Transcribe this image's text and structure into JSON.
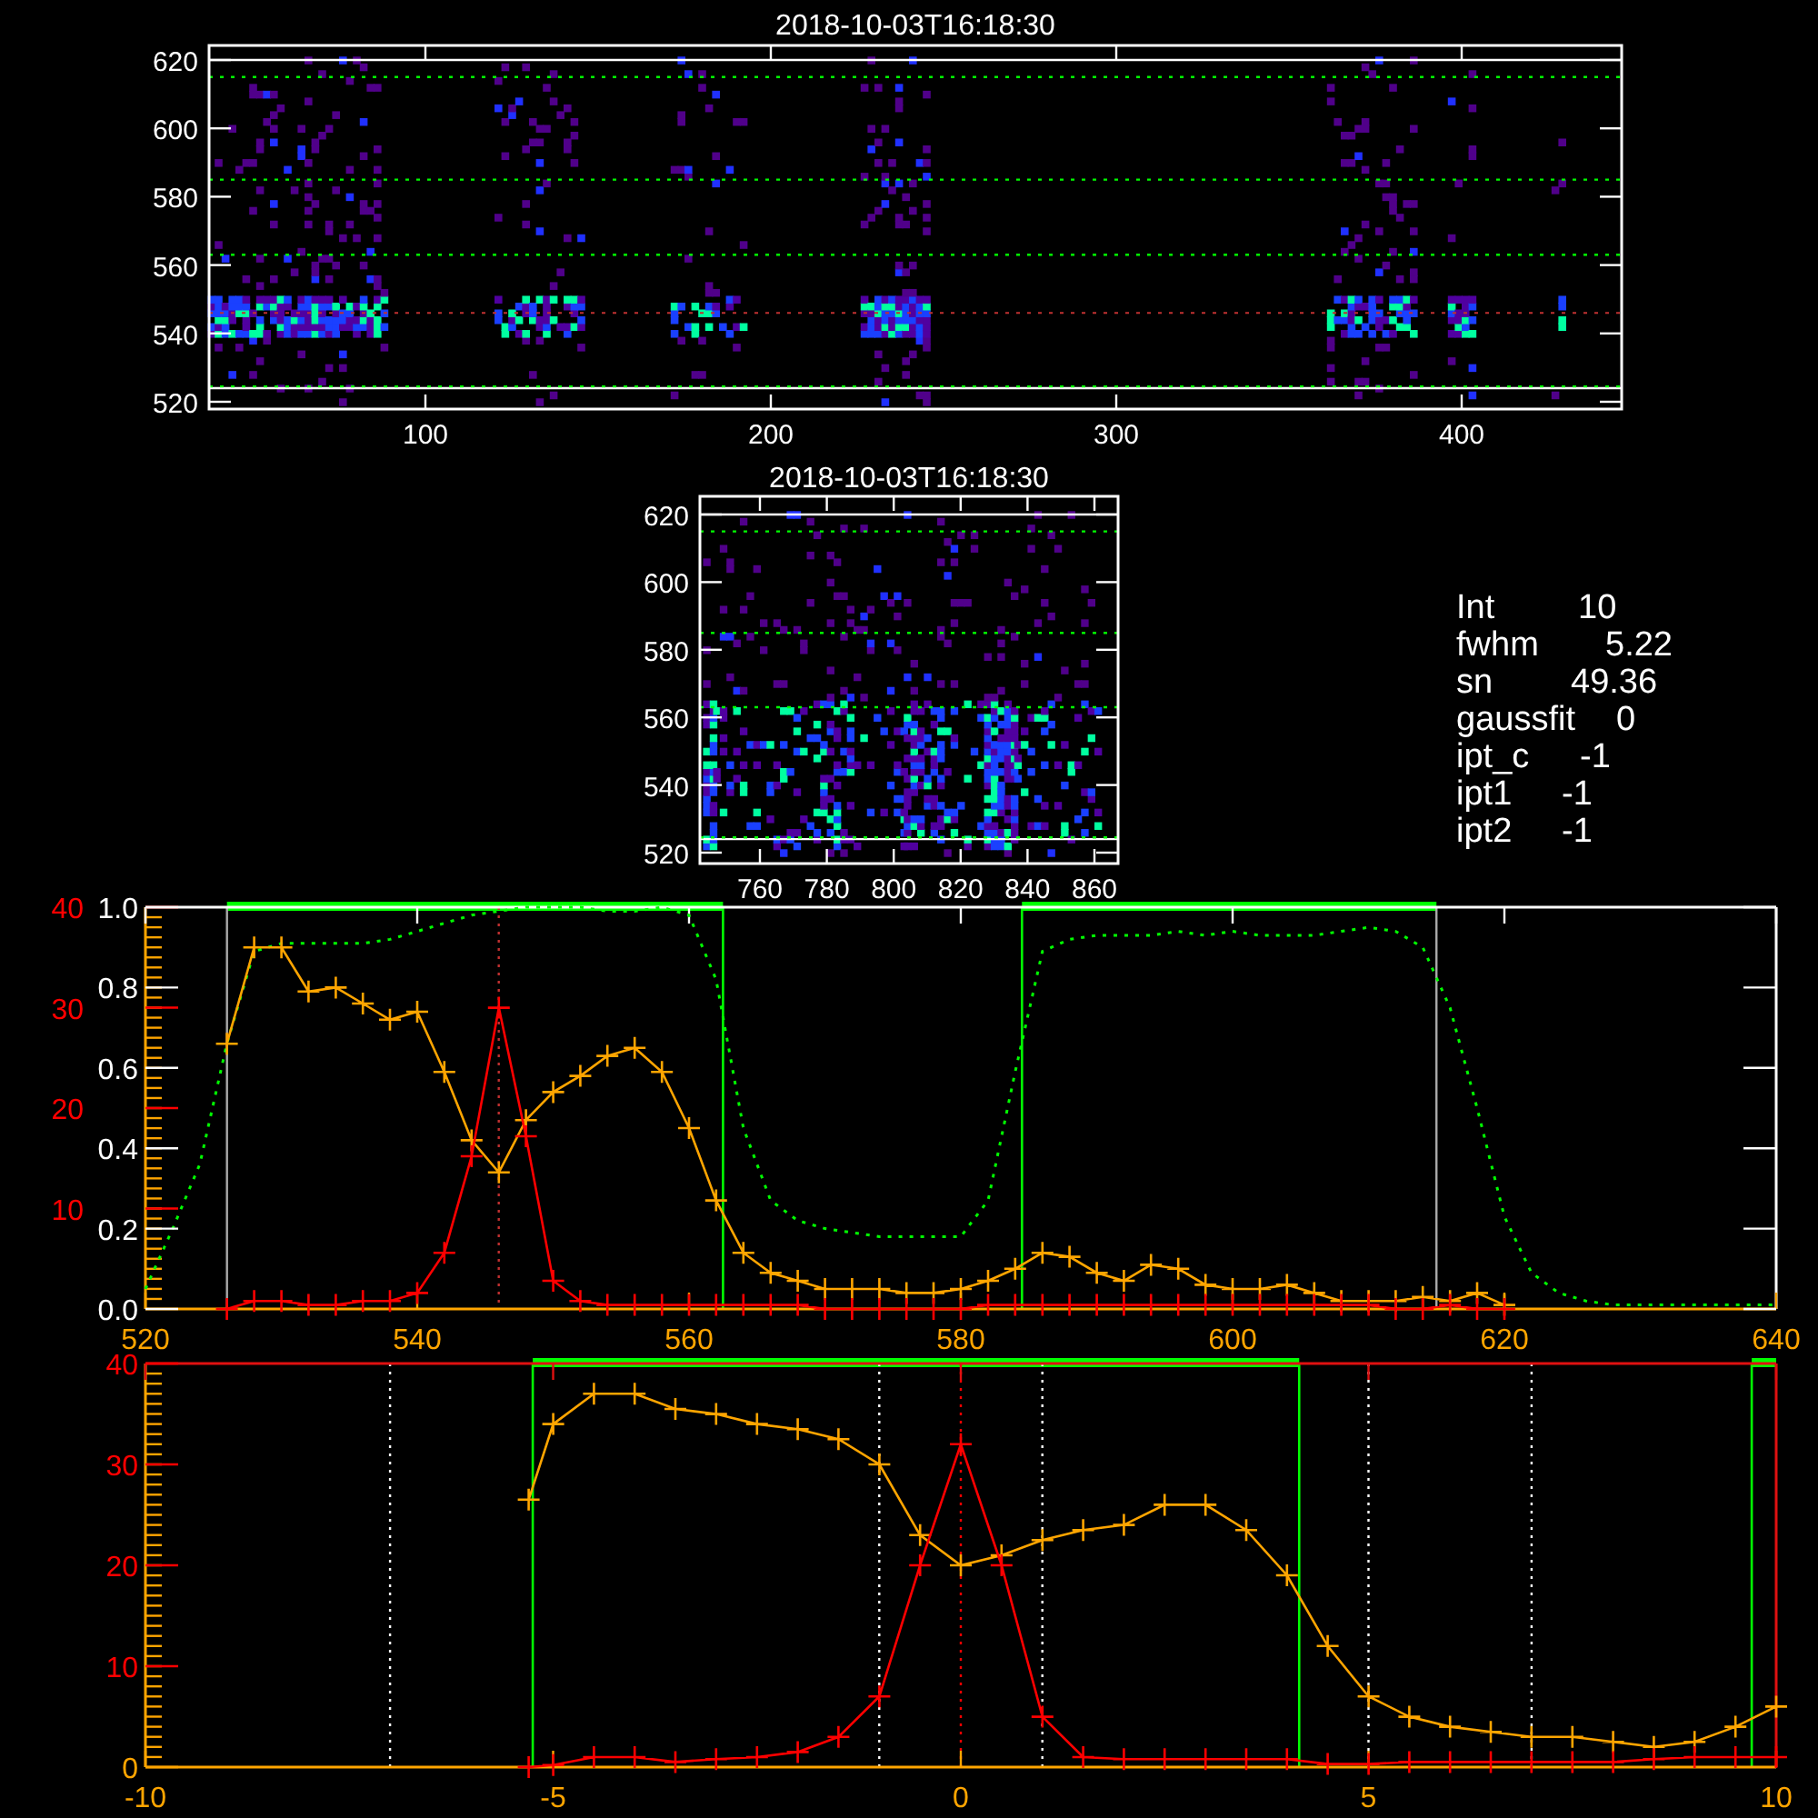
{
  "overview_panel": {
    "title": "2018-10-03T16:18:30",
    "xticks": [
      "100",
      "200",
      "300",
      "400"
    ],
    "yticks": [
      "620",
      "600",
      "580",
      "560",
      "540",
      "520"
    ]
  },
  "zoom_panel": {
    "title": "2018-10-03T16:18:30",
    "xticks": [
      "760",
      "780",
      "800",
      "820",
      "840",
      "860"
    ],
    "yticks": [
      "620",
      "600",
      "580",
      "560",
      "540",
      "520"
    ]
  },
  "fit_info": [
    {
      "label": "Int",
      "value": "10"
    },
    {
      "label": "fwhm",
      "value": "5.22"
    },
    {
      "label": "sn",
      "value": "49.36"
    },
    {
      "label": "gaussfit",
      "value": "0"
    },
    {
      "label": "ipt_c",
      "value": "-1"
    },
    {
      "label": "ipt1",
      "value": "-1"
    },
    {
      "label": "ipt2",
      "value": "-1"
    }
  ],
  "spectrum_panel": {
    "fraction_axis_labels": [
      "1.0",
      "0.8",
      "0.6",
      "0.4",
      "0.2",
      "0.0"
    ],
    "chart_data": {
      "type": "line",
      "xlim": [
        520,
        640
      ],
      "ylim": [
        0,
        40
      ],
      "xticks": [
        520,
        540,
        560,
        580,
        600,
        620,
        640
      ],
      "yticks": [
        10,
        20,
        30,
        40
      ],
      "x": [
        520,
        522,
        524,
        526,
        528,
        530,
        532,
        534,
        536,
        538,
        540,
        542,
        544,
        546,
        548,
        550,
        552,
        554,
        556,
        558,
        560,
        562,
        564,
        566,
        568,
        570,
        572,
        574,
        576,
        578,
        580,
        582,
        584,
        586,
        588,
        590,
        592,
        594,
        596,
        598,
        600,
        602,
        604,
        606,
        608,
        610,
        612,
        614,
        616,
        618,
        620,
        622,
        624,
        626,
        628,
        630,
        632,
        634,
        636,
        638,
        640
      ],
      "series": [
        {
          "color": "#00ff00",
          "line_style": "dotted",
          "marker": "none",
          "values": [
            2,
            8,
            14.4,
            26.4,
            35.6,
            36.4,
            36.4,
            36.4,
            36.4,
            36.8,
            37.6,
            38.4,
            39.2,
            39.6,
            40,
            40,
            40,
            39.6,
            39.6,
            40,
            39.2,
            32.8,
            18,
            10.8,
            8.8,
            8,
            7.6,
            7.2,
            7.2,
            7.2,
            7.2,
            10.8,
            23.6,
            35.6,
            36.8,
            37.2,
            37.2,
            37.2,
            37.6,
            37.2,
            37.6,
            37.2,
            37.2,
            37.2,
            37.6,
            38,
            37.6,
            36,
            30,
            20,
            9.2,
            3.6,
            1.6,
            0.8,
            0.4,
            0.4,
            0.4,
            0.4,
            0.4,
            0.4,
            0.4
          ]
        },
        {
          "color": "#ffa500",
          "line_style": "solid",
          "marker": "plus",
          "values": [
            null,
            null,
            null,
            26.4,
            36,
            36,
            31.6,
            32,
            30.4,
            28.8,
            29.6,
            23.6,
            16.8,
            13.6,
            18.8,
            21.6,
            23.2,
            25.2,
            26,
            23.6,
            18,
            10.8,
            5.6,
            3.6,
            2.8,
            2,
            2,
            2,
            1.6,
            1.6,
            2,
            2.8,
            4,
            5.6,
            5.2,
            3.6,
            2.8,
            4.4,
            4,
            2.4,
            2,
            2,
            2.4,
            1.6,
            0.8,
            0.8,
            0.8,
            1.2,
            0.8,
            1.6,
            0.4,
            null,
            null,
            null,
            null,
            null,
            null,
            null,
            null,
            null,
            null
          ]
        },
        {
          "color": "#ff0000",
          "line_style": "solid",
          "marker": "plus",
          "values": [
            null,
            null,
            null,
            0,
            0.8,
            0.8,
            0.4,
            0.4,
            0.8,
            0.8,
            1.6,
            5.6,
            15.2,
            30,
            17.2,
            2.8,
            0.8,
            0.4,
            0.4,
            0.4,
            0.4,
            0.4,
            0.4,
            0.4,
            0.4,
            0,
            0,
            0,
            0,
            0,
            0,
            0.4,
            0.4,
            0.4,
            0.4,
            0.4,
            0.4,
            0.4,
            0.4,
            0.4,
            0.4,
            0.4,
            0.4,
            0.4,
            0.4,
            0.4,
            0,
            0,
            0.4,
            0,
            0,
            null,
            null,
            null,
            null,
            null,
            null,
            null,
            null,
            null,
            null
          ]
        }
      ]
    }
  },
  "profile_panel": {
    "chart_data": {
      "type": "line",
      "xlim": [
        -10,
        10
      ],
      "ylim": [
        0,
        40
      ],
      "xticks": [
        -10,
        -5,
        0,
        5,
        10
      ],
      "yticks": [
        0,
        10,
        20,
        30,
        40
      ],
      "x": [
        -5.3,
        -5,
        -4.5,
        -4,
        -3.5,
        -3,
        -2.5,
        -2,
        -1.5,
        -1,
        -0.5,
        0,
        0.5,
        1,
        1.5,
        2,
        2.5,
        3,
        3.5,
        4,
        4.5,
        5,
        5.5,
        6,
        6.5,
        7,
        7.5,
        8,
        8.5,
        9,
        9.5,
        10
      ],
      "series": [
        {
          "color": "#ffa500",
          "line_style": "solid",
          "marker": "plus",
          "values": [
            26.5,
            34,
            37,
            37,
            35.5,
            35,
            34,
            33.5,
            32.5,
            30,
            23,
            20,
            21,
            22.5,
            23.5,
            24,
            26,
            26,
            23.5,
            19,
            12,
            7,
            5,
            4,
            3.5,
            3,
            3,
            2.5,
            2,
            2.5,
            4,
            6
          ]
        },
        {
          "color": "#ff0000",
          "line_style": "solid",
          "marker": "plus",
          "values": [
            0,
            0.2,
            1,
            1,
            0.5,
            0.8,
            1,
            1.5,
            3,
            7,
            20,
            32,
            20,
            5,
            1,
            0.8,
            0.8,
            0.8,
            0.8,
            0.8,
            0.3,
            0.3,
            0.5,
            0.5,
            0.5,
            0.5,
            0.5,
            0.5,
            0.8,
            1,
            1,
            1
          ]
        }
      ]
    }
  }
}
